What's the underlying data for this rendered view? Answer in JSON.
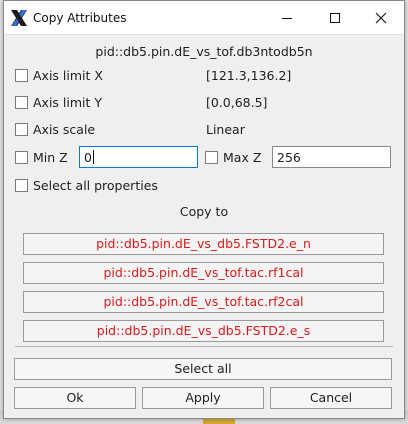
{
  "window": {
    "title": "Copy Attributes",
    "histogram_name": "pid::db5.pin.dE_vs_tof.db3ntodb5n"
  },
  "properties": [
    {
      "label": "Axis limit X",
      "value": "[121.3,136.2]",
      "checked": false
    },
    {
      "label": "Axis limit Y",
      "value": "[0.0,68.5]",
      "checked": false
    },
    {
      "label": "Axis scale",
      "value": "Linear",
      "checked": false
    }
  ],
  "min_z": {
    "label": "Min Z",
    "value": "0",
    "checked": false
  },
  "max_z": {
    "label": "Max Z",
    "value": "256",
    "checked": false
  },
  "select_all_properties": {
    "label": "Select all properties",
    "checked": false
  },
  "copy_to_label": "Copy to",
  "targets": [
    "pid::db5.pin.dE_vs_db5.FSTD2.e_n",
    "pid::db5.pin.dE_vs_tof.tac.rf1cal",
    "pid::db5.pin.dE_vs_tof.tac.rf2cal",
    "pid::db5.pin.dE_vs_db5.FSTD2.e_s"
  ],
  "buttons": {
    "select_all": "Select all",
    "ok": "Ok",
    "apply": "Apply",
    "cancel": "Cancel"
  },
  "colors": {
    "target_text": "#d81a1a",
    "focus_border": "#0078d4"
  },
  "icons": {
    "app": "x-logo-icon",
    "minimize": "minimize-icon",
    "maximize": "maximize-icon",
    "close": "close-icon"
  }
}
